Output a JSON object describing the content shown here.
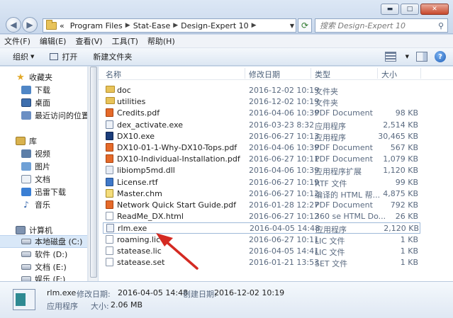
{
  "window": {
    "minimize_glyph": "▬",
    "maximize_glyph": "□",
    "close_glyph": "✕"
  },
  "address": {
    "prefix": "«",
    "crumbs": [
      "Program Files",
      "Stat-Ease",
      "Design-Expert 10"
    ],
    "search_placeholder": "搜索 Design-Expert 10"
  },
  "menu": [
    "文件(F)",
    "编辑(E)",
    "查看(V)",
    "工具(T)",
    "帮助(H)"
  ],
  "toolbar": {
    "organize": "组织",
    "open": "打开",
    "new_folder": "新建文件夹"
  },
  "nav": {
    "favorites": "收藏夹",
    "downloads": "下载",
    "desktop": "桌面",
    "recent": "最近访问的位置",
    "libraries": "库",
    "videos": "视频",
    "pictures": "图片",
    "documents": "文档",
    "thunder": "迅雷下载",
    "music": "音乐",
    "computer": "计算机",
    "drive_c": "本地磁盘 (C:)",
    "drive_d": "软件 (D:)",
    "drive_e": "文档 (E:)",
    "drive_f": "娱乐 (F:)"
  },
  "columns": {
    "name": "名称",
    "date": "修改日期",
    "type": "类型",
    "size": "大小"
  },
  "files": [
    {
      "name": "doc",
      "date": "2016-12-02 10:19",
      "type": "文件夹",
      "size": "",
      "icon": "folder"
    },
    {
      "name": "utilities",
      "date": "2016-12-02 10:19",
      "type": "文件夹",
      "size": "",
      "icon": "folder"
    },
    {
      "name": "Credits.pdf",
      "date": "2016-04-06 10:39",
      "type": "PDF Document",
      "size": "98 KB",
      "icon": "pdf"
    },
    {
      "name": "dex_activate.exe",
      "date": "2016-03-23 8:32",
      "type": "应用程序",
      "size": "2,514 KB",
      "icon": "exe"
    },
    {
      "name": "DX10.exe",
      "date": "2016-06-27 10:13",
      "type": "应用程序",
      "size": "30,465 KB",
      "icon": "dx"
    },
    {
      "name": "DX10-01-1-Why-DX10-Tops.pdf",
      "date": "2016-04-06 10:39",
      "type": "PDF Document",
      "size": "567 KB",
      "icon": "pdf"
    },
    {
      "name": "DX10-Individual-Installation.pdf",
      "date": "2016-06-27 10:11",
      "type": "PDF Document",
      "size": "1,079 KB",
      "icon": "pdf"
    },
    {
      "name": "libiomp5md.dll",
      "date": "2016-04-06 10:39",
      "type": "应用程序扩展",
      "size": "1,120 KB",
      "icon": "dll"
    },
    {
      "name": "License.rtf",
      "date": "2016-06-27 10:19",
      "type": "RTF 文件",
      "size": "99 KB",
      "icon": "rtf"
    },
    {
      "name": "Master.chm",
      "date": "2016-06-27 10:12",
      "type": "编译的 HTML 帮...",
      "size": "4,875 KB",
      "icon": "chm"
    },
    {
      "name": "Network Quick Start Guide.pdf",
      "date": "2016-01-28 12:27",
      "type": "PDF Document",
      "size": "792 KB",
      "icon": "pdf"
    },
    {
      "name": "ReadMe_DX.html",
      "date": "2016-06-27 10:12",
      "type": "360 se HTML Do...",
      "size": "26 KB",
      "icon": "html"
    },
    {
      "name": "rlm.exe",
      "date": "2016-04-05 14:48",
      "type": "应用程序",
      "size": "2,120 KB",
      "icon": "exe"
    },
    {
      "name": "roaming.lic",
      "date": "2016-06-27 10:11",
      "type": "LIC 文件",
      "size": "1 KB",
      "icon": "lic"
    },
    {
      "name": "statease.lic",
      "date": "2016-04-05 14:41",
      "type": "LIC 文件",
      "size": "1 KB",
      "icon": "lic"
    },
    {
      "name": "statease.set",
      "date": "2016-01-21 13:53",
      "type": "SET 文件",
      "size": "1 KB",
      "icon": "lic"
    }
  ],
  "selected_index": 12,
  "details": {
    "name": "rlm.exe",
    "modified_label": "修改日期:",
    "modified": "2016-04-05 14:48",
    "created_label": "创建日期:",
    "created": "2016-12-02 10:19",
    "type": "应用程序",
    "size_label": "大小:",
    "size": "2.06 MB"
  },
  "colors": {
    "arrow": "#d42a22",
    "selection_border": "#9fb9d9"
  }
}
